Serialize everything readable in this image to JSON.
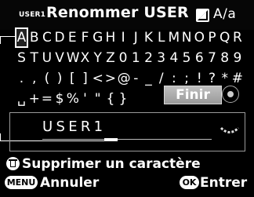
{
  "header": {
    "mode_tag": "USER1",
    "title": "Renommer USER",
    "case_toggle": "A/a",
    "case_icon": "case-switch-icon"
  },
  "keyboard": {
    "rows": [
      [
        "A",
        "B",
        "C",
        "D",
        "E",
        "F",
        "G",
        "H",
        "I",
        "J",
        "K",
        "L",
        "M",
        "N",
        "O",
        "P",
        "Q",
        "R"
      ],
      [
        "S",
        "T",
        "U",
        "V",
        "W",
        "X",
        "Y",
        "Z",
        "0",
        "1",
        "2",
        "3",
        "4",
        "5",
        "6",
        "7",
        "8",
        "9"
      ],
      [
        ".",
        ",",
        "(",
        ")",
        "[",
        "]",
        "<",
        ">",
        "@",
        "-",
        "_",
        "/",
        ":",
        ";",
        "!",
        "?",
        "*",
        "#"
      ],
      [
        "␣",
        "+",
        "=",
        "$",
        "%",
        "'",
        "\"",
        "{",
        "}"
      ]
    ],
    "selected": "A",
    "finish_label": "Finir",
    "dial_icon": "four-way-controller-icon"
  },
  "input": {
    "value": "USER1",
    "wheel_icon": "rear-dial-icon"
  },
  "footer": {
    "delete_label": "Supprimer un caractère",
    "delete_icon": "trash-icon",
    "menu_badge": "MENU",
    "cancel_label": "Annuler",
    "ok_badge": "OK",
    "enter_label": "Entrer"
  }
}
